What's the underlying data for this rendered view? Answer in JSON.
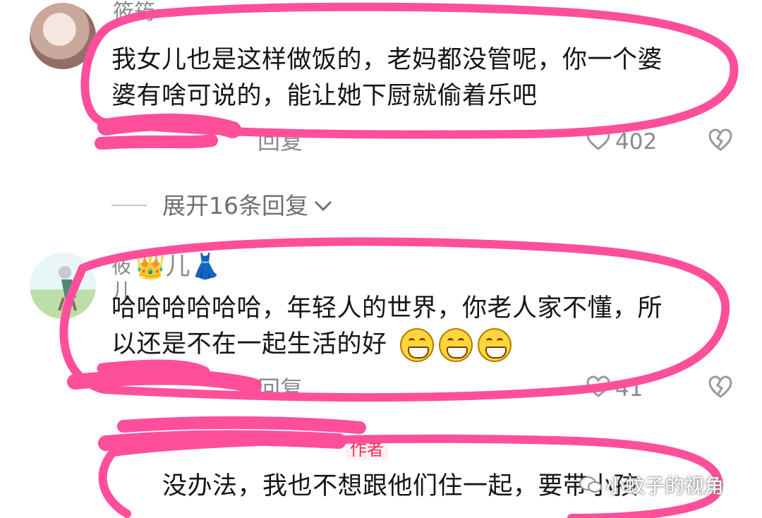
{
  "comments": [
    {
      "username": "筱筠",
      "text_line1": "我女儿也是这样做饭的，老妈都没管呢，你一个婆",
      "text_line2": "婆有啥可说的，能让她下厨就偷着乐吧",
      "reply_label": "回复",
      "like_count": "402"
    },
    {
      "username": "筱儿",
      "name_emojis": "👑👗",
      "text_line1": "哈哈哈哈哈哈，年轻人的世界，你老人家不懂，所",
      "text_line2": "以还是不在一起生活的好",
      "reply_label": "回复",
      "like_count": "41"
    },
    {
      "author_tag": "作者",
      "text_line1": "没办法，我也不想跟他们住一起，要带小孩"
    }
  ],
  "expand_label": "展开16条回复",
  "watermark_text": "小蚊子的视角",
  "colors": {
    "highlight": "#ff4f9b",
    "muted": "#8a8a8a",
    "author": "#fe2c55"
  },
  "icons": [
    "heart-icon",
    "broken-heart-icon",
    "chevron-down-icon",
    "watermark-logo-icon"
  ]
}
